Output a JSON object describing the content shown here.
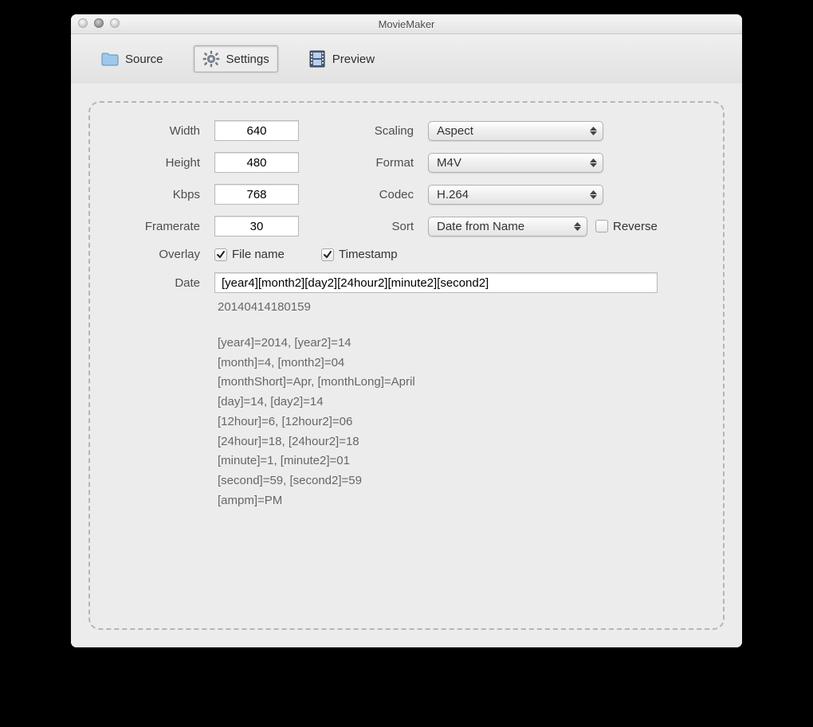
{
  "window": {
    "title": "MovieMaker"
  },
  "toolbar": {
    "source": "Source",
    "settings": "Settings",
    "preview": "Preview"
  },
  "labels": {
    "width": "Width",
    "height": "Height",
    "kbps": "Kbps",
    "framerate": "Framerate",
    "overlay": "Overlay",
    "date": "Date",
    "scaling": "Scaling",
    "format": "Format",
    "codec": "Codec",
    "sort": "Sort",
    "reverse": "Reverse",
    "file_name": "File name",
    "timestamp": "Timestamp"
  },
  "values": {
    "width": "640",
    "height": "480",
    "kbps": "768",
    "framerate": "30",
    "scaling": "Aspect",
    "format": "M4V",
    "codec": "H.264",
    "sort": "Date from Name",
    "reverse_checked": false,
    "file_name_checked": true,
    "timestamp_checked": true,
    "date_pattern": "[year4][month2][day2][24hour2][minute2][second2]"
  },
  "info": {
    "example": "20140414180159",
    "lines": [
      "[year4]=2014, [year2]=14",
      "[month]=4, [month2]=04",
      "[monthShort]=Apr, [monthLong]=April",
      "[day]=14, [day2]=14",
      "[12hour]=6, [12hour2]=06",
      "[24hour]=18, [24hour2]=18",
      "[minute]=1, [minute2]=01",
      "[second]=59, [second2]=59",
      "[ampm]=PM"
    ]
  }
}
